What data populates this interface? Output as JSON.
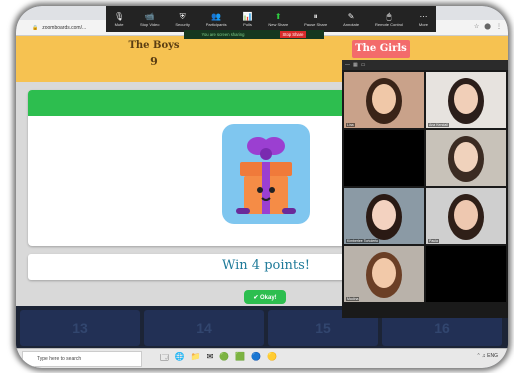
{
  "zoom": {
    "toolbar": [
      {
        "icon": "microphone-icon",
        "label": "Mute",
        "glyph": "🎙"
      },
      {
        "icon": "video-icon",
        "label": "Stop Video",
        "glyph": "📹"
      },
      {
        "icon": "shield-icon",
        "label": "Security",
        "glyph": "⛨"
      },
      {
        "icon": "participants-icon",
        "label": "Participants",
        "glyph": "👥"
      },
      {
        "icon": "chat-icon",
        "label": "Polls",
        "glyph": "📊"
      },
      {
        "icon": "share-icon",
        "label": "New Share",
        "glyph": "⬆"
      },
      {
        "icon": "pause-share-icon",
        "label": "Pause Share",
        "glyph": "⏸"
      },
      {
        "icon": "annotate-icon",
        "label": "Annotate",
        "glyph": "✎"
      },
      {
        "icon": "remote-control-icon",
        "label": "Remote Control",
        "glyph": "🖱"
      },
      {
        "icon": "more-icon",
        "label": "More",
        "glyph": "⋯"
      }
    ],
    "sharing_label": "You are screen sharing",
    "stop_share_label": "Stop Share",
    "recording_label": "Stop Share",
    "gallery": [
      {
        "name": "Lina",
        "bg": "#c9a28a",
        "face": "#f0c8a8",
        "hair": "#3a2418"
      },
      {
        "name": "Ana Kendall",
        "bg": "#e7e3df",
        "face": "#f1cfb8",
        "hair": "#2b1e1a"
      },
      {
        "name": "",
        "bg": "#000000",
        "face": "",
        "hair": ""
      },
      {
        "name": "",
        "bg": "#c8c2b9",
        "face": "#f0d2bc",
        "hair": "#3b2b22"
      },
      {
        "name": "Kimberlee Tortolerto",
        "bg": "#8b9aa5",
        "face": "#f3d2c0",
        "hair": "#2a1a14"
      },
      {
        "name": "Paula",
        "bg": "#cfcfcf",
        "face": "#eec8b0",
        "hair": "#2f1f18"
      },
      {
        "name": "Madina",
        "bg": "#b9b2aa",
        "face": "#f2c9a9",
        "hair": "#6b3f26"
      },
      {
        "name": "",
        "bg": "#000000",
        "face": "",
        "hair": ""
      }
    ]
  },
  "browser": {
    "url": "zoomboards.com/...",
    "right_icons": [
      "☆",
      "⬤",
      "⋮"
    ]
  },
  "game": {
    "teams": [
      {
        "name": "The Boys",
        "score": "9"
      },
      {
        "name": "The Girls",
        "score": ""
      }
    ],
    "result_text": "Win 4 points!",
    "okay_label": "✔ Okay!",
    "tiles": [
      "13",
      "14",
      "15",
      "16"
    ],
    "colors": {
      "score_bar": "#f6c251",
      "girls": "#f36b6b",
      "green": "#2dbe4f",
      "result": "#1e7a99"
    }
  },
  "taskbar": {
    "search_placeholder": "Type here to search",
    "apps": [
      "🗔",
      "🌐",
      "📁",
      "✉",
      "🟢",
      "🟩",
      "🔵",
      "🟡"
    ],
    "tray": "⌃ ♫ ENG"
  }
}
